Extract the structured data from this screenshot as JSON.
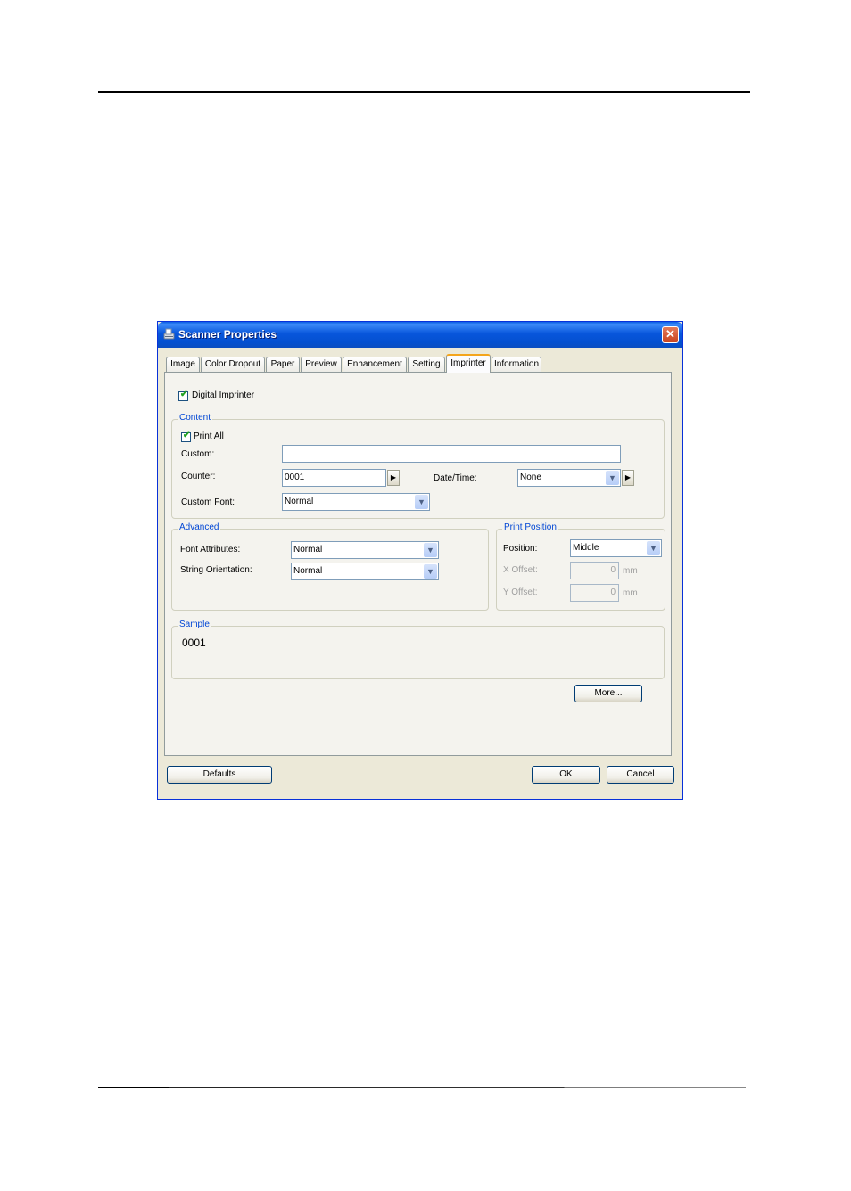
{
  "dialog": {
    "title": "Scanner Properties",
    "icon": "scanner-icon",
    "close_glyph": "✕"
  },
  "tabs": [
    {
      "label": "Image",
      "active": false
    },
    {
      "label": "Color Dropout",
      "active": false
    },
    {
      "label": "Paper",
      "active": false
    },
    {
      "label": "Preview",
      "active": false
    },
    {
      "label": "Enhancement",
      "active": false
    },
    {
      "label": "Setting",
      "active": false
    },
    {
      "label": "Imprinter",
      "active": true
    },
    {
      "label": "Information",
      "active": false
    }
  ],
  "imprinter": {
    "digital_imprinter": {
      "label": "Digital Imprinter",
      "checked": true
    },
    "content": {
      "title": "Content",
      "print_all": {
        "label": "Print All",
        "checked": true
      },
      "custom_label": "Custom:",
      "custom_value": "",
      "counter_label": "Counter:",
      "counter_value": "0001",
      "date_time_label": "Date/Time:",
      "date_time_value": "None",
      "custom_font_label": "Custom Font:",
      "custom_font_value": "Normal"
    },
    "advanced": {
      "title": "Advanced",
      "font_attributes_label": "Font Attributes:",
      "font_attributes_value": "Normal",
      "string_orientation_label": "String Orientation:",
      "string_orientation_value": "Normal"
    },
    "print_position": {
      "title": "Print Position",
      "position_label": "Position:",
      "position_value": "Middle",
      "x_offset_label": "X Offset:",
      "x_offset_value": "0",
      "y_offset_label": "Y Offset:",
      "y_offset_value": "0",
      "unit": "mm"
    },
    "sample": {
      "title": "Sample",
      "value": "0001"
    },
    "more_label": "More..."
  },
  "footer": {
    "defaults_label": "Defaults",
    "ok_label": "OK",
    "cancel_label": "Cancel"
  },
  "glyphs": {
    "check": "✔",
    "dropdown": "▼",
    "spin_right": "▶"
  }
}
